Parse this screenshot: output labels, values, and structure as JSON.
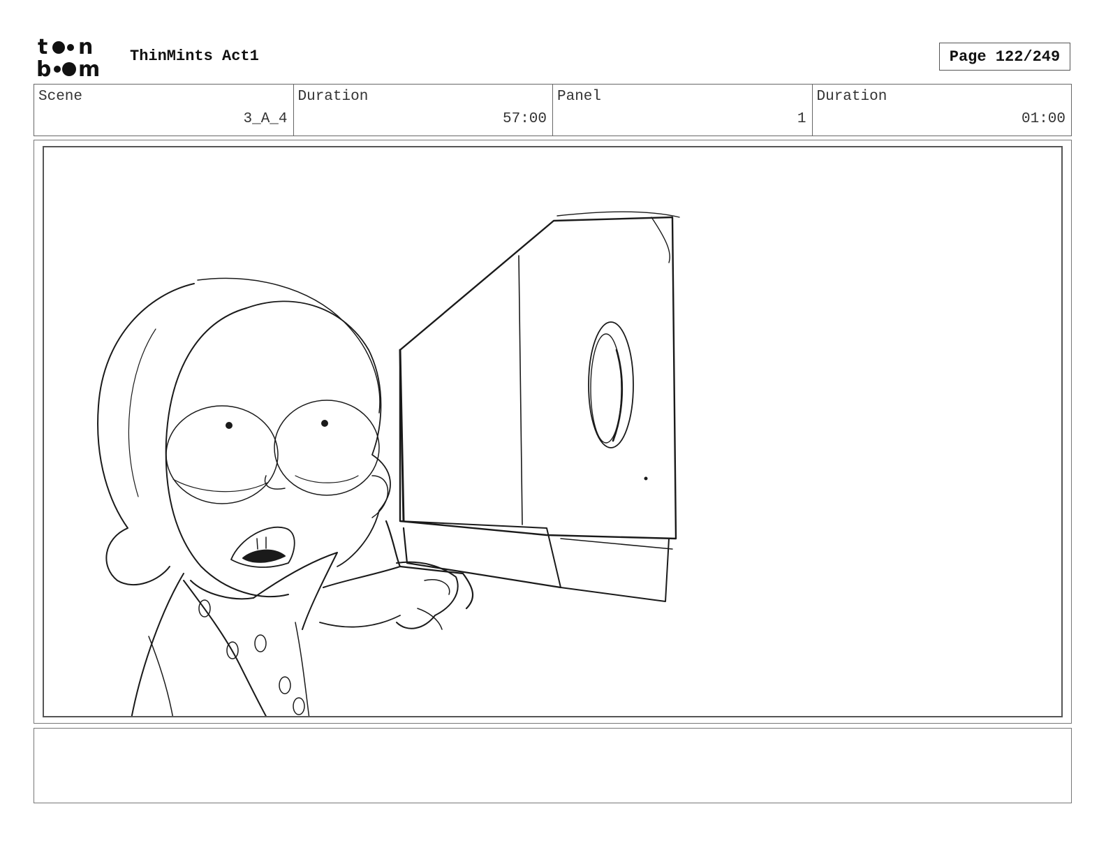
{
  "header": {
    "logo_line1": "toon",
    "logo_line2": "boom",
    "project_title": "ThinMints Act1",
    "page_label": "Page 122/249"
  },
  "info": [
    {
      "label": "Scene",
      "value": "3_A_4"
    },
    {
      "label": "Duration",
      "value": "57:00"
    },
    {
      "label": "Panel",
      "value": "1"
    },
    {
      "label": "Duration",
      "value": "01:00"
    }
  ],
  "notes": {
    "text": ""
  },
  "colors": {
    "sketch": "#1a1a1a",
    "border": "#666666"
  }
}
